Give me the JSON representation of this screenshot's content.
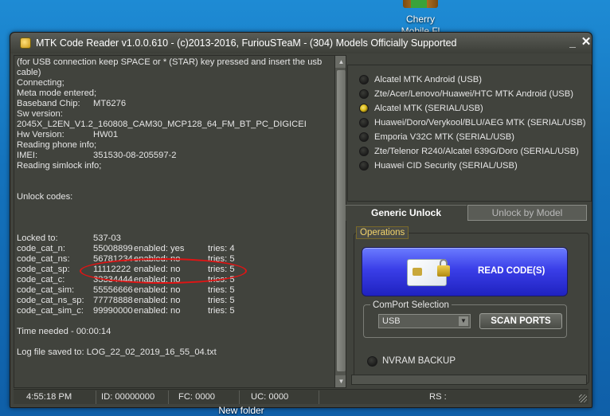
{
  "desktop": {
    "icon_top_label": "Cherry",
    "icon_top_label2": "Mobile Fl",
    "icon_bottom_label": "New folder"
  },
  "window": {
    "title": "MTK Code Reader v1.0.0.610 - (c)2013-2016, FuriouSTeaM - (304) Models Officially Supported",
    "minimize": "_",
    "close": "✕"
  },
  "log": {
    "intro": "(for USB connection keep SPACE or * (STAR) key pressed and insert the usb cable)",
    "connecting": "Connecting;",
    "meta": "Meta mode entered;",
    "baseband_key": "Baseband Chip:",
    "baseband_val": "MT6276",
    "sw_key": "Sw version:",
    "sw_val": "2045X_L2EN_V1.2_160808_CAM30_MCP128_64_FM_BT_PC_DIGICEI",
    "hw_key": "Hw Version:",
    "hw_val": "HW01",
    "reading_info": "Reading phone info;",
    "imei_key": "IMEI:",
    "imei_val": "351530-08-205597-2",
    "reading_simlock": "Reading simlock info;",
    "unlock_codes": "Unlock codes:",
    "locked_key": "Locked to:",
    "locked_val": "537-03",
    "codes": [
      {
        "name": "code_cat_n:",
        "code": "55008899",
        "enabled": "enabled: yes",
        "tries": "tries: 4"
      },
      {
        "name": "code_cat_ns:",
        "code": "56781234",
        "enabled": "enabled: no",
        "tries": "tries: 5"
      },
      {
        "name": "code_cat_sp:",
        "code": "11112222",
        "enabled": "enabled: no",
        "tries": "tries: 5"
      },
      {
        "name": "code_cat_c:",
        "code": "33334444",
        "enabled": "enabled: no",
        "tries": "tries: 5"
      },
      {
        "name": "code_cat_sim:",
        "code": "55556666",
        "enabled": "enabled: no",
        "tries": "tries: 5"
      },
      {
        "name": "code_cat_ns_sp:",
        "code": "77778888",
        "enabled": "enabled: no",
        "tries": "tries: 5"
      },
      {
        "name": "code_cat_sim_c:",
        "code": "99990000",
        "enabled": "enabled: no",
        "tries": "tries: 5"
      }
    ],
    "time_needed": "Time needed - 00:00:14",
    "log_saved": "Log file saved to: LOG_22_02_2019_16_55_04.txt"
  },
  "models": [
    {
      "label": "Alcatel MTK Android (USB)",
      "selected": false
    },
    {
      "label": "Zte/Acer/Lenovo/Huawei/HTC MTK Android (USB)",
      "selected": false
    },
    {
      "label": "Alcatel MTK (SERIAL/USB)",
      "selected": true
    },
    {
      "label": "Huawei/Doro/Verykool/BLU/AEG MTK (SERIAL/USB)",
      "selected": false
    },
    {
      "label": "Emporia V32C MTK (SERIAL/USB)",
      "selected": false
    },
    {
      "label": "Zte/Telenor R240/Alcatel 639G/Doro (SERIAL/USB)",
      "selected": false
    },
    {
      "label": "Huawei CID Security (SERIAL/USB)",
      "selected": false
    }
  ],
  "tabs": {
    "generic": "Generic Unlock",
    "by_model": "Unlock by Model"
  },
  "operations": {
    "label": "Operations",
    "read_button": "READ CODE(S)",
    "comport_label": "ComPort Selection",
    "comport_value": "USB",
    "scan_button": "SCAN PORTS",
    "nvram_label": "NVRAM BACKUP"
  },
  "status": {
    "time": "4:55:18 PM",
    "id": "ID: 00000000",
    "fc": "FC: 0000",
    "uc": "UC: 0000",
    "rs": "RS :"
  },
  "colors": {
    "window_bg": "#41433d",
    "read_button": "#3a3ee8",
    "accent_yellow": "#f2d36b",
    "annotation": "#e01414"
  }
}
